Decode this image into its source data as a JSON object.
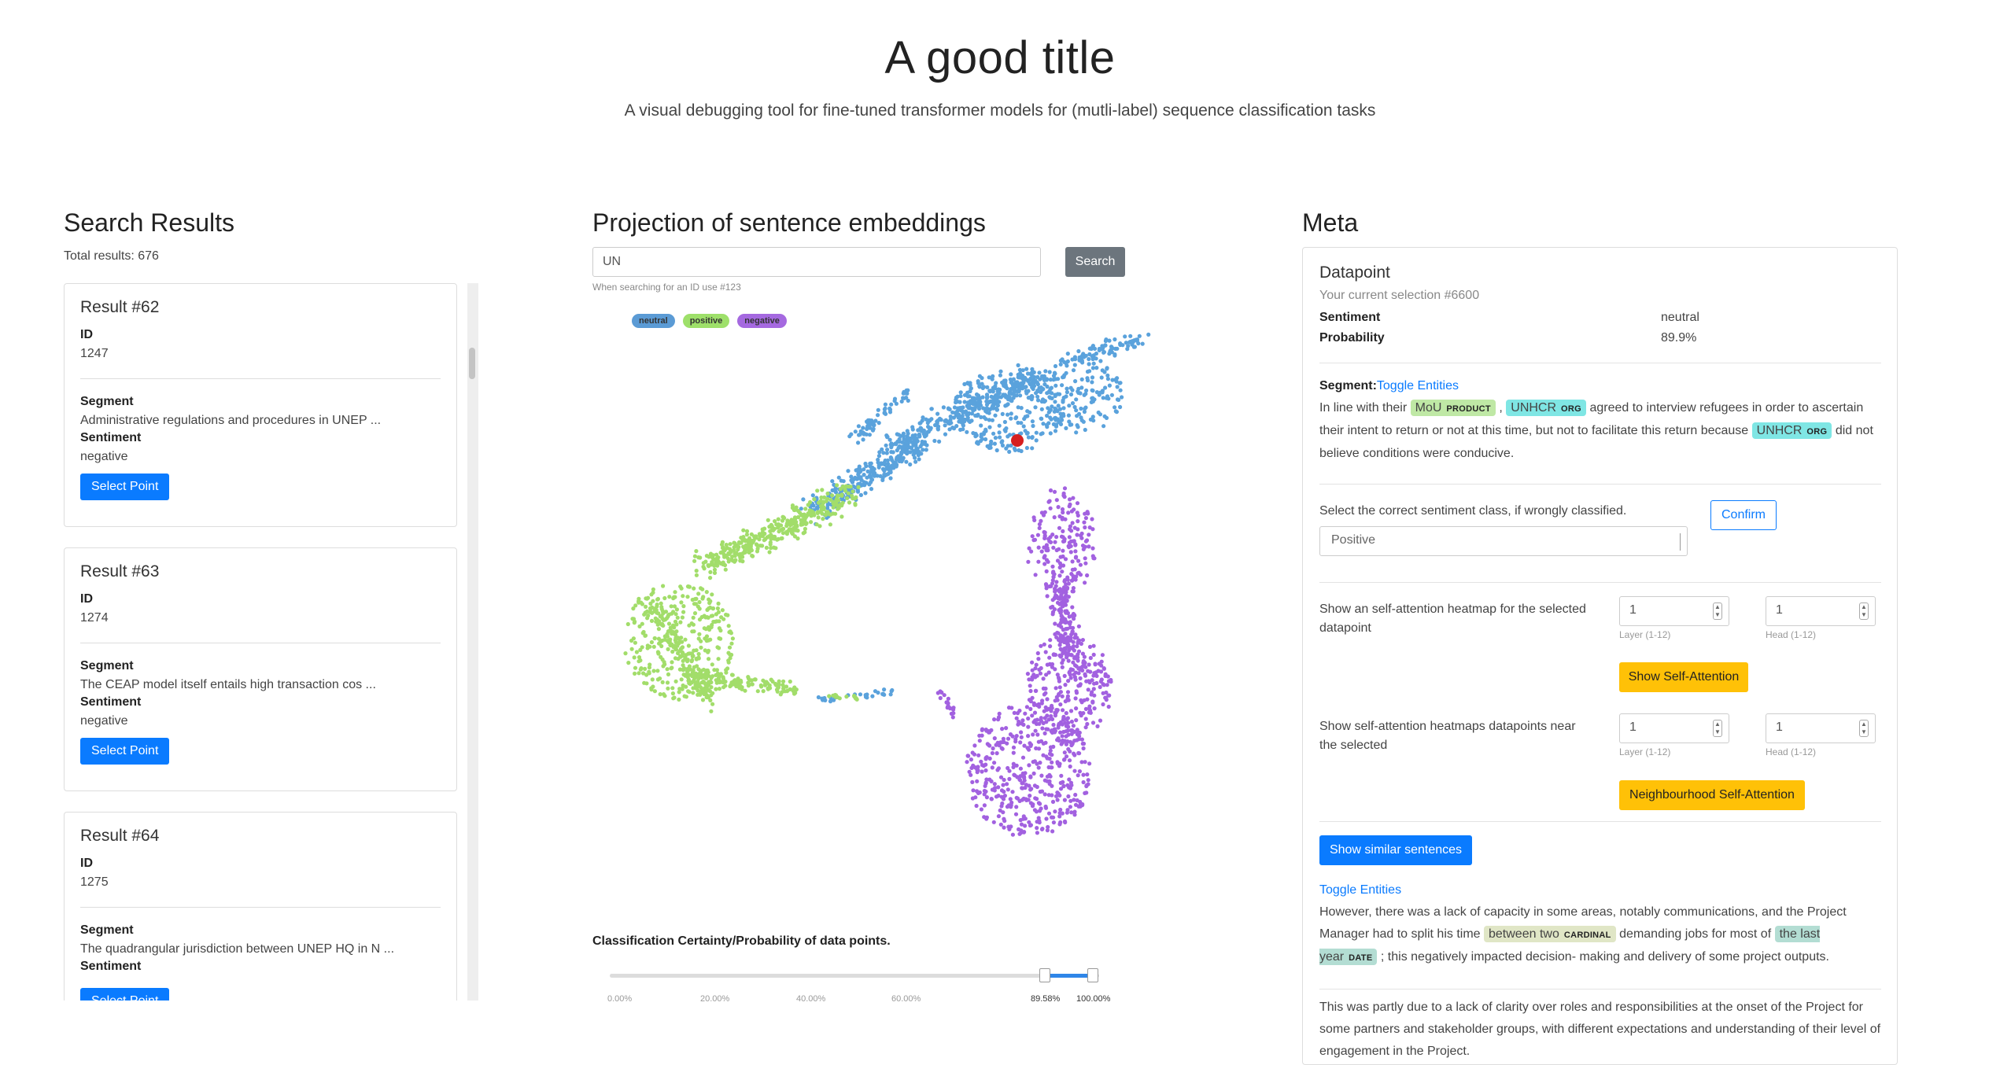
{
  "header": {
    "title": "A good title",
    "subtitle": "A visual debugging tool for fine-tuned transformer models for (mutli-label) sequence classification tasks"
  },
  "search_results": {
    "heading": "Search Results",
    "total": "Total results: 676",
    "results": [
      {
        "title": "Result #62",
        "id_label": "ID",
        "id": "1247",
        "segment_label": "Segment",
        "segment": "Administrative regulations and procedures in UNEP ...",
        "sentiment_label": "Sentiment",
        "sentiment": "negative",
        "button": "Select Point"
      },
      {
        "title": "Result #63",
        "id_label": "ID",
        "id": "1274",
        "segment_label": "Segment",
        "segment": "The CEAP model itself entails high transaction cos ...",
        "sentiment_label": "Sentiment",
        "sentiment": "negative",
        "button": "Select Point"
      },
      {
        "title": "Result #64",
        "id_label": "ID",
        "id": "1275",
        "segment_label": "Segment",
        "segment": "The quadrangular jurisdiction between UNEP HQ in N ...",
        "sentiment_label": "Sentiment",
        "sentiment": "",
        "button": "Select Point"
      }
    ]
  },
  "projection": {
    "heading": "Projection of sentence embeddings",
    "search_value": "UN",
    "search_button": "Search",
    "hint": "When searching for an ID use #123",
    "legend": [
      {
        "label": "neutral",
        "color": "#5b9bd5"
      },
      {
        "label": "positive",
        "color": "#9ee06a"
      },
      {
        "label": "negative",
        "color": "#a569e0"
      }
    ],
    "colors": {
      "neutral": "#5aa2dc",
      "positive": "#a2dd6a",
      "negative": "#a261e0",
      "selected": "#d61f1f"
    }
  },
  "certainty": {
    "title": "Classification Certainty/Probability of data points.",
    "ticks": [
      "0.00%",
      "20.00%",
      "40.00%",
      "60.00%"
    ],
    "selected_low": "89.58%",
    "selected_high": "100.00%",
    "range": [
      0.8958,
      1.0
    ]
  },
  "meta": {
    "heading": "Meta",
    "datapoint_title": "Datapoint",
    "selection": "Your current selection #6600",
    "sentiment_label": "Sentiment",
    "sentiment_value": "neutral",
    "probability_label": "Probability",
    "probability_value": "89.9%",
    "segment_label": "Segment:",
    "toggle_entities": "Toggle Entities",
    "segment_parts": {
      "p1": "In line with their",
      "e1": "MoU",
      "e1_tag": "PRODUCT",
      "p2": ",",
      "e2": "UNHCR",
      "e2_tag": "ORG",
      "p3": "agreed to interview refugees in order to ascertain their intent to return or not at this time, but not to facilitate this return because",
      "e3": "UNHCR",
      "e3_tag": "ORG",
      "p4": "did not believe conditions were conducive."
    },
    "correct_label": "Select the correct sentiment class, if wrongly classified.",
    "correct_select": "Positive",
    "confirm_button": "Confirm",
    "attn_label": "Show an self-attention heatmap for the selected datapoint",
    "attn_layer": "1",
    "attn_head": "1",
    "layer_hint": "Layer (1-12)",
    "head_hint": "Head (1-12)",
    "attn_button": "Show Self-Attention",
    "neigh_label": "Show self-attention heatmaps datapoints near the selected",
    "neigh_layer": "1",
    "neigh_head": "1",
    "neigh_button": "Neighbourhood Self-Attention",
    "similar_button": "Show similar sentences",
    "similar_toggle": "Toggle Entities",
    "similar_parts": {
      "p1": "However, there was a lack of capacity in some areas, notably communications, and the Project Manager had to split his time",
      "e1": "between two",
      "e1_tag": "CARDINAL",
      "p2": "demanding jobs for most of",
      "e2": "the last year",
      "e2_tag": "DATE",
      "p3": "; this negatively impacted decision- making and delivery of some project outputs."
    },
    "similar2": "This was partly due to a lack of clarity over roles and responsibilities at the onset of the Project for some partners and stakeholder groups, with different expectations and understanding of their level of engagement in the Project."
  }
}
